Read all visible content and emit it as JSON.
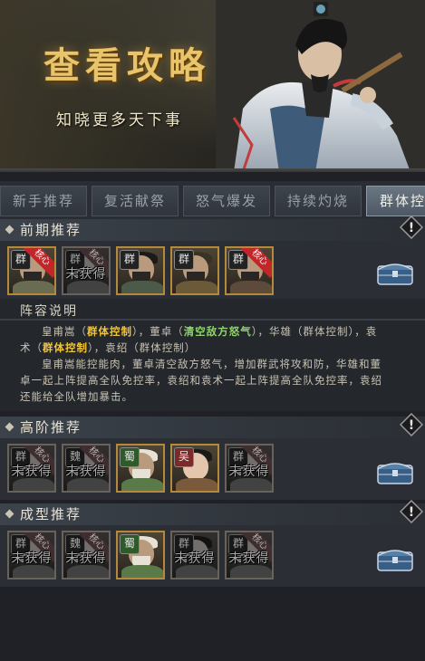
{
  "banner": {
    "title": "查看攻略",
    "subtitle": "知晓更多天下事"
  },
  "tabs": [
    {
      "label": "新手推荐",
      "active": false
    },
    {
      "label": "复活献祭",
      "active": false
    },
    {
      "label": "怒气爆发",
      "active": false
    },
    {
      "label": "持续灼烧",
      "active": false
    },
    {
      "label": "群体控",
      "active": true
    }
  ],
  "sections": {
    "early": {
      "title": "前期推荐",
      "heroes": [
        {
          "faction": "群",
          "core": "核心",
          "unobtained": ""
        },
        {
          "faction": "群",
          "core": "核心",
          "unobtained": "未获得"
        },
        {
          "faction": "群",
          "core": "",
          "unobtained": ""
        },
        {
          "faction": "群",
          "core": "",
          "unobtained": ""
        },
        {
          "faction": "群",
          "core": "核心",
          "unobtained": ""
        }
      ]
    },
    "advanced": {
      "title": "高阶推荐",
      "heroes": [
        {
          "faction": "群",
          "core": "核心",
          "unobtained": "未获得"
        },
        {
          "faction": "魏",
          "core": "核心",
          "unobtained": "未获得"
        },
        {
          "faction": "蜀",
          "core": "",
          "unobtained": ""
        },
        {
          "faction": "吴",
          "core": "",
          "unobtained": ""
        },
        {
          "faction": "群",
          "core": "核心",
          "unobtained": "未获得"
        }
      ]
    },
    "formed": {
      "title": "成型推荐",
      "heroes": [
        {
          "faction": "群",
          "core": "核心",
          "unobtained": "未获得"
        },
        {
          "faction": "魏",
          "core": "核心",
          "unobtained": "未获得"
        },
        {
          "faction": "蜀",
          "core": "",
          "unobtained": ""
        },
        {
          "faction": "群",
          "core": "",
          "unobtained": "未获得"
        },
        {
          "faction": "群",
          "core": "核心",
          "unobtained": "未获得"
        }
      ]
    }
  },
  "lineup": {
    "title": "阵容说明",
    "line1_a": "皇甫嵩（",
    "line1_b": "群体控制",
    "line1_c": "），董卓（",
    "line1_d": "清空敌方怒气",
    "line1_e": "），华雄（群体控制），袁",
    "line2_a": "术（",
    "line2_b": "群体控制",
    "line2_c": "），袁绍（群体控制）",
    "line3": "皇甫嵩能控能肉，董卓清空敌方怒气，增加群武将攻和防，华雄和董",
    "line4": "卓一起上阵提高全队免控率，袁绍和袁术一起上阵提高全队免控率，袁绍",
    "line5": "还能给全队增加暴击。"
  },
  "colors": {
    "accent_gold": "#e9c46a",
    "highlight_yellow": "#f0c53d",
    "highlight_green": "#8fd36a",
    "core_red": "#c0262a"
  }
}
